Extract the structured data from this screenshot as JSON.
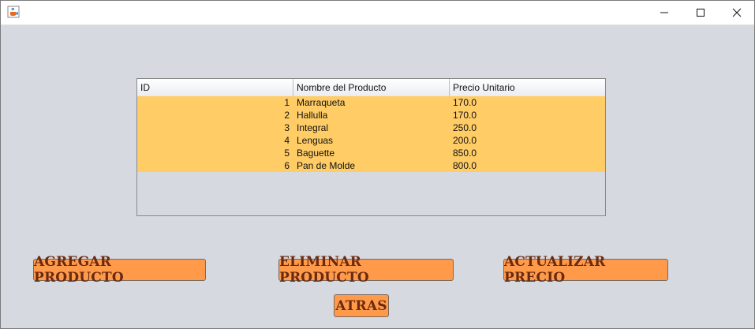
{
  "window": {
    "app_icon": "java-coffee-icon",
    "controls": {
      "minimize_icon": "minimize-icon",
      "maximize_icon": "maximize-icon",
      "close_icon": "close-icon"
    }
  },
  "table": {
    "columns": [
      "ID",
      "Nombre del Producto",
      "Precio Unitario"
    ],
    "rows": [
      {
        "id": "1",
        "name": "Marraqueta",
        "price": "170.0"
      },
      {
        "id": "2",
        "name": "Hallulla",
        "price": "170.0"
      },
      {
        "id": "3",
        "name": "Integral",
        "price": "250.0"
      },
      {
        "id": "4",
        "name": "Lenguas",
        "price": "200.0"
      },
      {
        "id": "5",
        "name": "Baguette",
        "price": "850.0"
      },
      {
        "id": "6",
        "name": "Pan de Molde",
        "price": "800.0"
      }
    ],
    "row_color": "#ffcc66"
  },
  "buttons": {
    "add": "AGREGAR PRODUCTO",
    "delete": "ELIMINAR PRODUCTO",
    "update": "ACTUALIZAR PRECIO",
    "back": "ATRAS"
  },
  "colors": {
    "button_bg": "#ff9a4a",
    "button_text": "#6a2a10",
    "background": "#d6d9e0"
  }
}
